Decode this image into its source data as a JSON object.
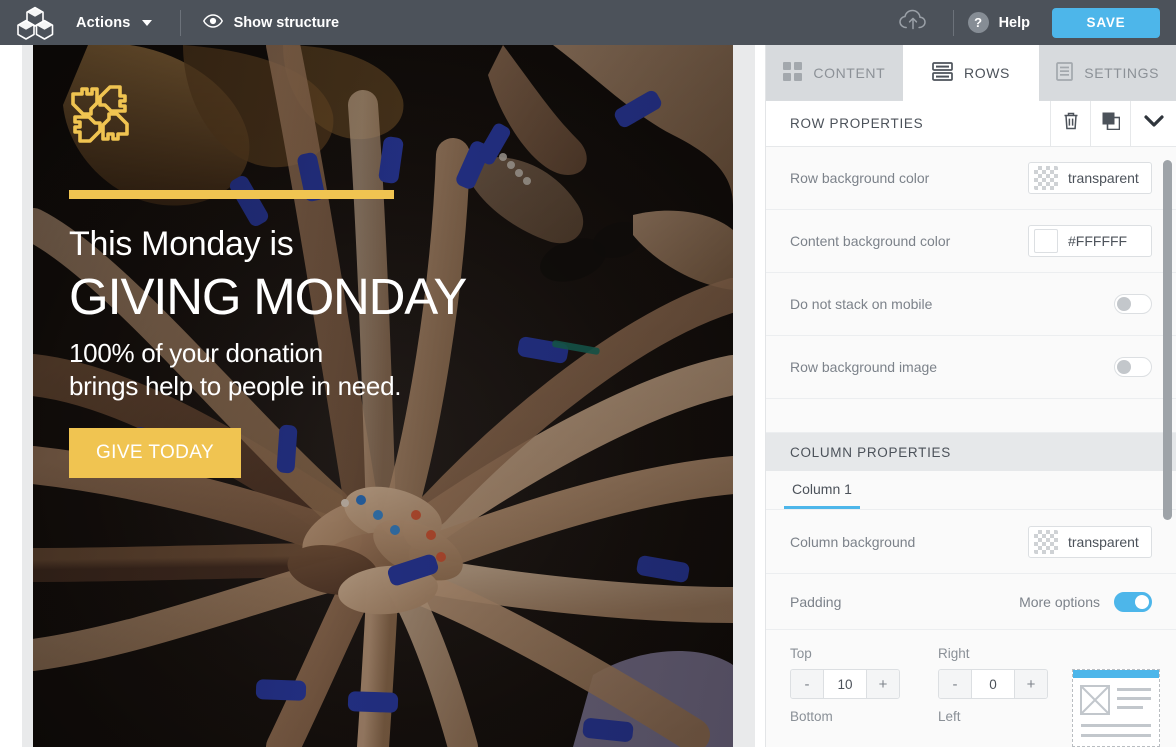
{
  "topbar": {
    "logo_icon": "cubes-logo-icon",
    "actions_label": "Actions",
    "caret_icon": "chevron-down-icon",
    "show_structure_label": "Show structure",
    "eye_icon": "eye-icon",
    "upload_icon": "cloud-upload-icon",
    "help_icon": "question-mark-icon",
    "help_label": "Help",
    "save_label": "SAVE",
    "bg_color": "#4C525A",
    "save_color": "#4DB6EA"
  },
  "email": {
    "logo_icon": "four-hands-teamwork-icon",
    "accent_color": "#F0C451",
    "heading_small": "This Monday is",
    "heading_big": "GIVING MONDAY",
    "subheading_line1": "100% of your donation",
    "subheading_line2": "brings help to people in need.",
    "cta_label": "GIVE TODAY"
  },
  "panel": {
    "tabs": [
      {
        "label": "CONTENT",
        "icon": "grid-squares-icon",
        "active": false
      },
      {
        "label": "ROWS",
        "icon": "rows-stack-icon",
        "active": true
      },
      {
        "label": "SETTINGS",
        "icon": "document-lines-icon",
        "active": false
      }
    ],
    "row_properties": {
      "title": "ROW PROPERTIES",
      "delete_icon": "trash-icon",
      "duplicate_icon": "copy-icon",
      "collapse_icon": "chevron-down-icon",
      "fields": [
        {
          "label": "Row background color",
          "type": "color",
          "value": "transparent",
          "swatch": "checker"
        },
        {
          "label": "Content background color",
          "type": "color",
          "value": "#FFFFFF",
          "swatch": "white"
        },
        {
          "label": "Do not stack on mobile",
          "type": "toggle",
          "value": "off"
        },
        {
          "label": "Row background image",
          "type": "toggle",
          "value": "off"
        }
      ]
    },
    "column_properties": {
      "title": "COLUMN PROPERTIES",
      "column_tab": "Column 1",
      "column_background_label": "Column background",
      "column_background_value": "transparent",
      "padding_label": "Padding",
      "more_options_label": "More options",
      "more_options_value": "on",
      "padding": [
        {
          "label": "Top",
          "value": "10"
        },
        {
          "label": "Right",
          "value": "0"
        },
        {
          "label": "Bottom",
          "value": ""
        },
        {
          "label": "Left",
          "value": ""
        }
      ],
      "minus_label": "-",
      "plus_label": "+",
      "preview_icon": "layout-preview-thumbnail"
    }
  }
}
